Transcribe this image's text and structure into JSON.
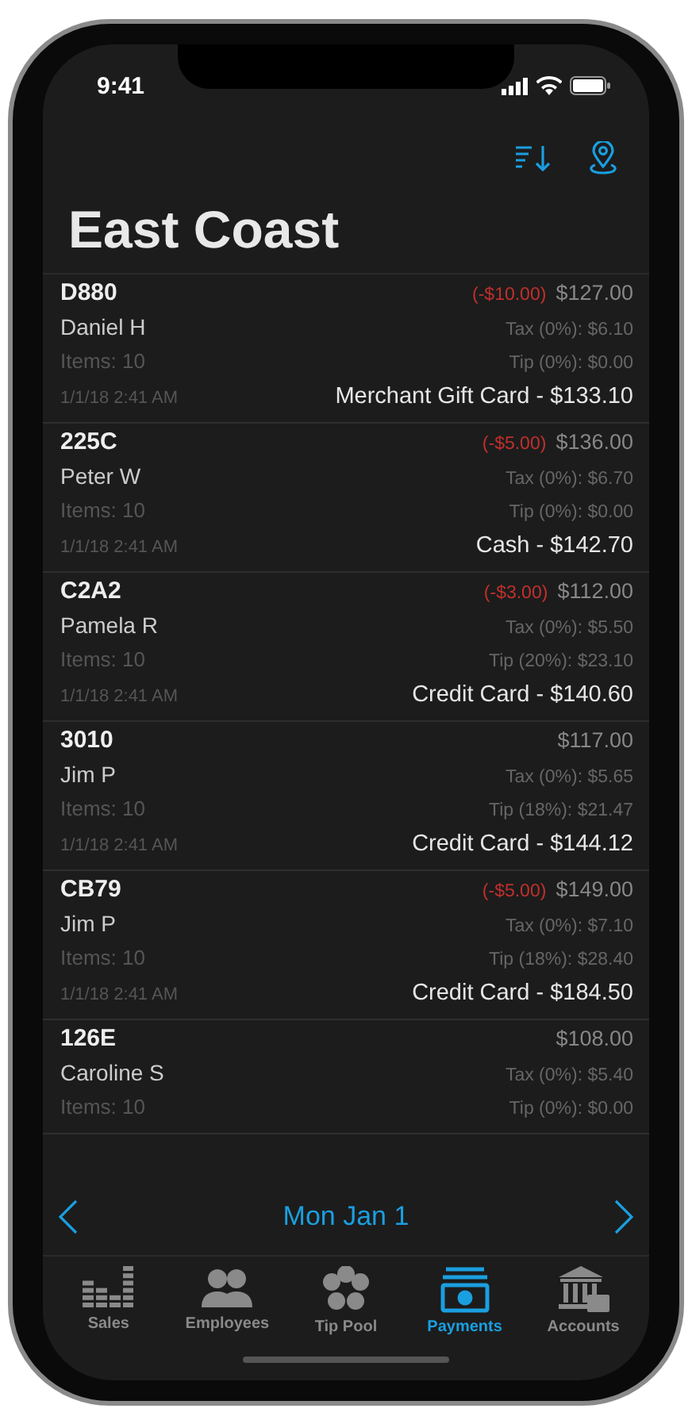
{
  "status_bar": {
    "time": "9:41"
  },
  "title": "East Coast",
  "payments": [
    {
      "order": "D880",
      "discount": "(-$10.00)",
      "subtotal": "$127.00",
      "employee": "Daniel H",
      "tax": "Tax (0%): $6.10",
      "items": "Items: 10",
      "tip": "Tip (0%): $0.00",
      "date": "1/1/18 2:41 AM",
      "total": "Merchant Gift Card - $133.10"
    },
    {
      "order": "225C",
      "discount": "(-$5.00)",
      "subtotal": "$136.00",
      "employee": "Peter W",
      "tax": "Tax (0%): $6.70",
      "items": "Items: 10",
      "tip": "Tip (0%): $0.00",
      "date": "1/1/18 2:41 AM",
      "total": "Cash - $142.70"
    },
    {
      "order": "C2A2",
      "discount": "(-$3.00)",
      "subtotal": "$112.00",
      "employee": "Pamela R",
      "tax": "Tax (0%): $5.50",
      "items": "Items: 10",
      "tip": "Tip (20%): $23.10",
      "date": "1/1/18 2:41 AM",
      "total": "Credit Card - $140.60"
    },
    {
      "order": "3010",
      "subtotal": "$117.00",
      "employee": "Jim P",
      "tax": "Tax (0%): $5.65",
      "items": "Items: 10",
      "tip": "Tip (18%): $21.47",
      "date": "1/1/18 2:41 AM",
      "total": "Credit Card - $144.12"
    },
    {
      "order": "CB79",
      "discount": "(-$5.00)",
      "subtotal": "$149.00",
      "employee": "Jim P",
      "tax": "Tax (0%): $7.10",
      "items": "Items: 10",
      "tip": "Tip (18%): $28.40",
      "date": "1/1/18 2:41 AM",
      "total": "Credit Card - $184.50"
    },
    {
      "order": "126E",
      "subtotal": "$108.00",
      "employee": "Caroline S",
      "tax": "Tax (0%): $5.40",
      "items": "Items: 10",
      "tip": "Tip (0%): $0.00"
    }
  ],
  "date_bar": {
    "date": "Mon Jan 1"
  },
  "tabs": [
    {
      "label": "Sales",
      "selected": false
    },
    {
      "label": "Employees",
      "selected": false
    },
    {
      "label": "Tip Pool",
      "selected": false
    },
    {
      "label": "Payments",
      "selected": true
    },
    {
      "label": "Accounts",
      "selected": false
    }
  ]
}
